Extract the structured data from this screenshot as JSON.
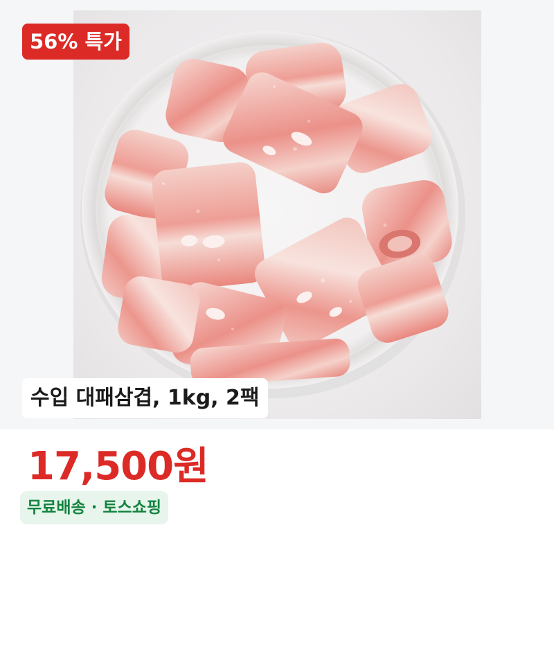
{
  "product": {
    "badge_label": "56% 특가",
    "title": "수입 대패삼겹, 1kg, 2팩",
    "price": "17,500원",
    "shipping_label": "무료배송 · 토스쇼핑",
    "image_alt": "frozen sliced pork belly rolls on a white plate"
  },
  "colors": {
    "accent_red": "#dc2a26",
    "shipping_green": "#13823f",
    "shipping_bg": "#e7f5ec",
    "hero_bg": "#f5f6f8"
  }
}
